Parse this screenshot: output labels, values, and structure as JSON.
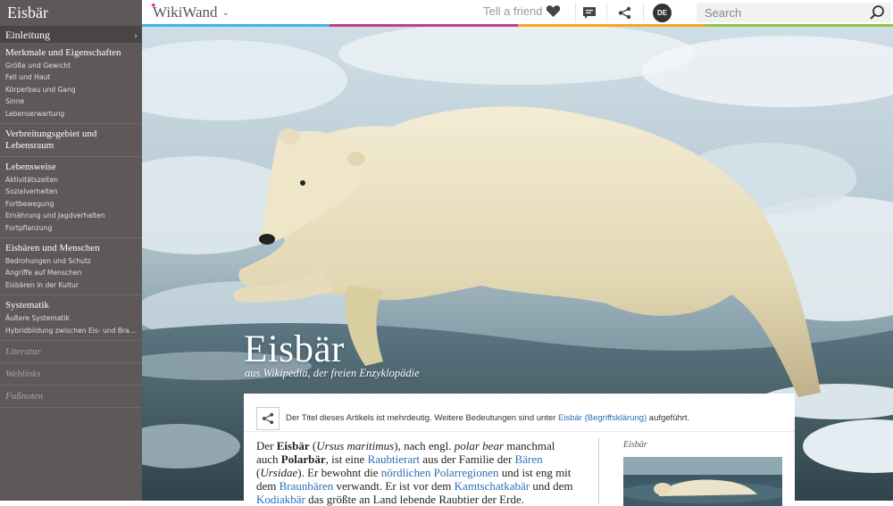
{
  "sidebar": {
    "title": "Eisbär",
    "active_item": "Einleitung",
    "sections": [
      {
        "heading": "Merkmale und Eigenschaften",
        "items": [
          "Größe und Gewicht",
          "Fell und Haut",
          "Körperbau und Gang",
          "Sinne",
          "Lebenserwartung"
        ]
      },
      {
        "heading": "Verbreitungsgebiet und Lebensraum",
        "items": []
      },
      {
        "heading": "Lebensweise",
        "items": [
          "Aktivitätszeiten",
          "Sozialverhalten",
          "Fortbewegung",
          "Ernährung und Jagdverhalten",
          "Fortpflanzung"
        ]
      },
      {
        "heading": "Eisbären und Menschen",
        "items": [
          "Bedrohungen und Schutz",
          "Angriffe auf Menschen",
          "Eisbären in der Kultur"
        ]
      },
      {
        "heading": "Systematik",
        "items": [
          "Äußere Systematik",
          "Hybridbildung zwischen Eis- und Bra..."
        ]
      }
    ],
    "muted_items": [
      "Literatur",
      "Weblinks",
      "Fußnoten"
    ]
  },
  "topbar": {
    "logo": "WikiWand",
    "tell_friend": "Tell a friend",
    "language": "DE",
    "search_placeholder": "Search",
    "colors": [
      "#3fb6e8",
      "#c43c8e",
      "#f6a623",
      "#8cc63f"
    ]
  },
  "hero": {
    "title": "Eisbär",
    "subtitle": "aus Wikipedia, der freien Enzyklopädie"
  },
  "notice": {
    "text_before": "Der Titel dieses Artikels ist mehrdeutig. Weitere Bedeutungen sind unter ",
    "link": "Eisbär (Begriffsklärung)",
    "text_after": " aufgeführt."
  },
  "article": {
    "p1": "Der ",
    "b1": "Eisbär",
    "p2": " (",
    "i1": "Ursus maritimus",
    "p3": "), nach engl. ",
    "i2": "polar bear",
    "p4": " manchmal auch ",
    "b2": "Polarbär",
    "p5": ", ist eine ",
    "l1": "Raubtierart",
    "p6": " aus der Familie der ",
    "l2": "Bären",
    "p7": " (",
    "i3": "Ursidae",
    "p8": "). Er bewohnt die ",
    "l3": "nördlichen Polarregionen",
    "p9": " und ist eng mit dem ",
    "l4": "Braunbären",
    "p10": " verwandt. Er ist vor dem ",
    "l5": "Kamtschatkabär",
    "p11": " und dem ",
    "l6": "Kodiakbär",
    "p12": " das größte an Land lebende Raubtier der Erde."
  },
  "infobox": {
    "title": "Eisbär"
  }
}
